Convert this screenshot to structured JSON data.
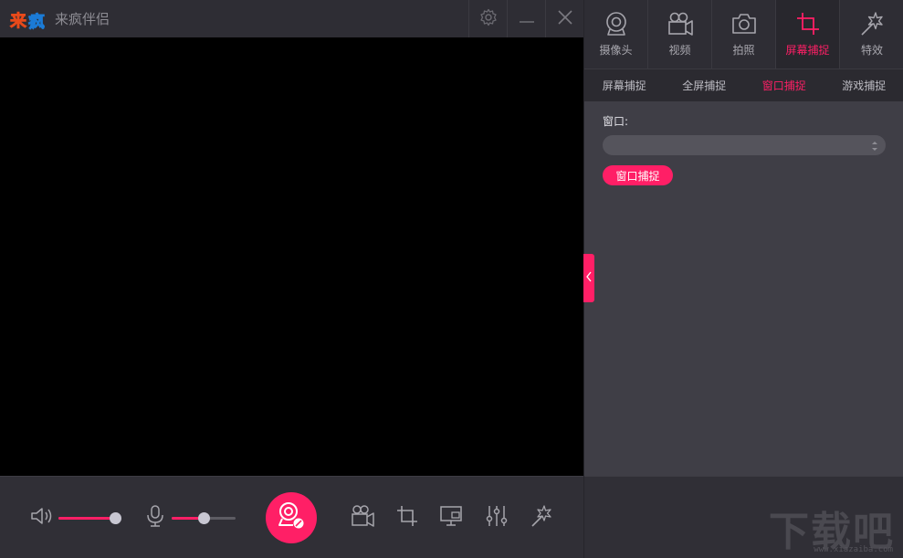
{
  "app": {
    "title": "来疯伴侣",
    "logo_text": "来疯"
  },
  "colors": {
    "accent": "#ff1f66",
    "preview_bg": "#000000",
    "panel_bg": "#3f3e46"
  },
  "titlebar": {
    "icons": [
      "gear-icon",
      "minimize-icon",
      "close-icon"
    ]
  },
  "bottombar": {
    "volume_level": 0.92,
    "mic_level": 0.5,
    "icons": [
      "speaker-icon",
      "microphone-icon",
      "record-icon",
      "video-camera-icon",
      "crop-icon",
      "screen-share-icon",
      "equalizer-icon",
      "effects-icon"
    ]
  },
  "tabs": [
    {
      "label": "摄像头",
      "icon": "webcam-icon",
      "active": false
    },
    {
      "label": "视频",
      "icon": "video-camera-icon",
      "active": false
    },
    {
      "label": "拍照",
      "icon": "camera-icon",
      "active": false
    },
    {
      "label": "屏幕捕捉",
      "icon": "crop-icon",
      "active": true
    },
    {
      "label": "特效",
      "icon": "magic-icon",
      "active": false
    }
  ],
  "subtabs": [
    {
      "label": "屏幕捕捉",
      "active": false
    },
    {
      "label": "全屏捕捉",
      "active": false
    },
    {
      "label": "窗口捕捉",
      "active": true
    },
    {
      "label": "游戏捕捉",
      "active": false
    }
  ],
  "window_capture": {
    "label": "窗口:",
    "selected": "",
    "button_label": "窗口捕捉"
  },
  "watermark": {
    "text": "下载吧",
    "url": "www.xiazaiba.com"
  }
}
